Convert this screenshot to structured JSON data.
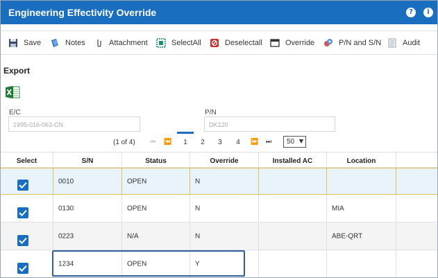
{
  "window": {
    "title": "Engineering Effectivity Override"
  },
  "header_icons": [
    "help-icon",
    "info-icon"
  ],
  "toolbar": {
    "save": "Save",
    "notes": "Notes",
    "attachment": "Attachment",
    "selectall": "SelectAll",
    "deselectall": "Deselectall",
    "override": "Override",
    "pn_sn": "P/N and S/N",
    "audit": "Audit"
  },
  "export": {
    "label": "Export",
    "icon": "excel-icon"
  },
  "form": {
    "ec_label": "E/C",
    "ec_value": "1995-016-063-CN",
    "pn_label": "P/N",
    "pn_value": "DK120"
  },
  "pager": {
    "summary": "(1 of 4)",
    "pages": [
      "1",
      "2",
      "3",
      "4"
    ],
    "current_page": "1",
    "page_size": "50"
  },
  "table": {
    "columns": [
      "Select",
      "S/N",
      "Status",
      "Override",
      "Installed AC",
      "Location"
    ],
    "rows": [
      {
        "checked": true,
        "sn": "0010",
        "status": "OPEN",
        "override": "N",
        "installed_ac": "",
        "location": ""
      },
      {
        "checked": true,
        "sn": "0130",
        "status": "OPEN",
        "override": "N",
        "installed_ac": "",
        "location": "MIA"
      },
      {
        "checked": true,
        "sn": "0223",
        "status": "N/A",
        "override": "N",
        "installed_ac": "",
        "location": "ABE-QRT"
      },
      {
        "checked": true,
        "sn": "1234",
        "status": "OPEN",
        "override": "Y",
        "installed_ac": "",
        "location": ""
      }
    ]
  },
  "colors": {
    "header": "#1a6ec0",
    "selected_row": "#e8f4fa",
    "selected_border": "#e3c15a",
    "highlight_box": "#2e5f9c"
  }
}
